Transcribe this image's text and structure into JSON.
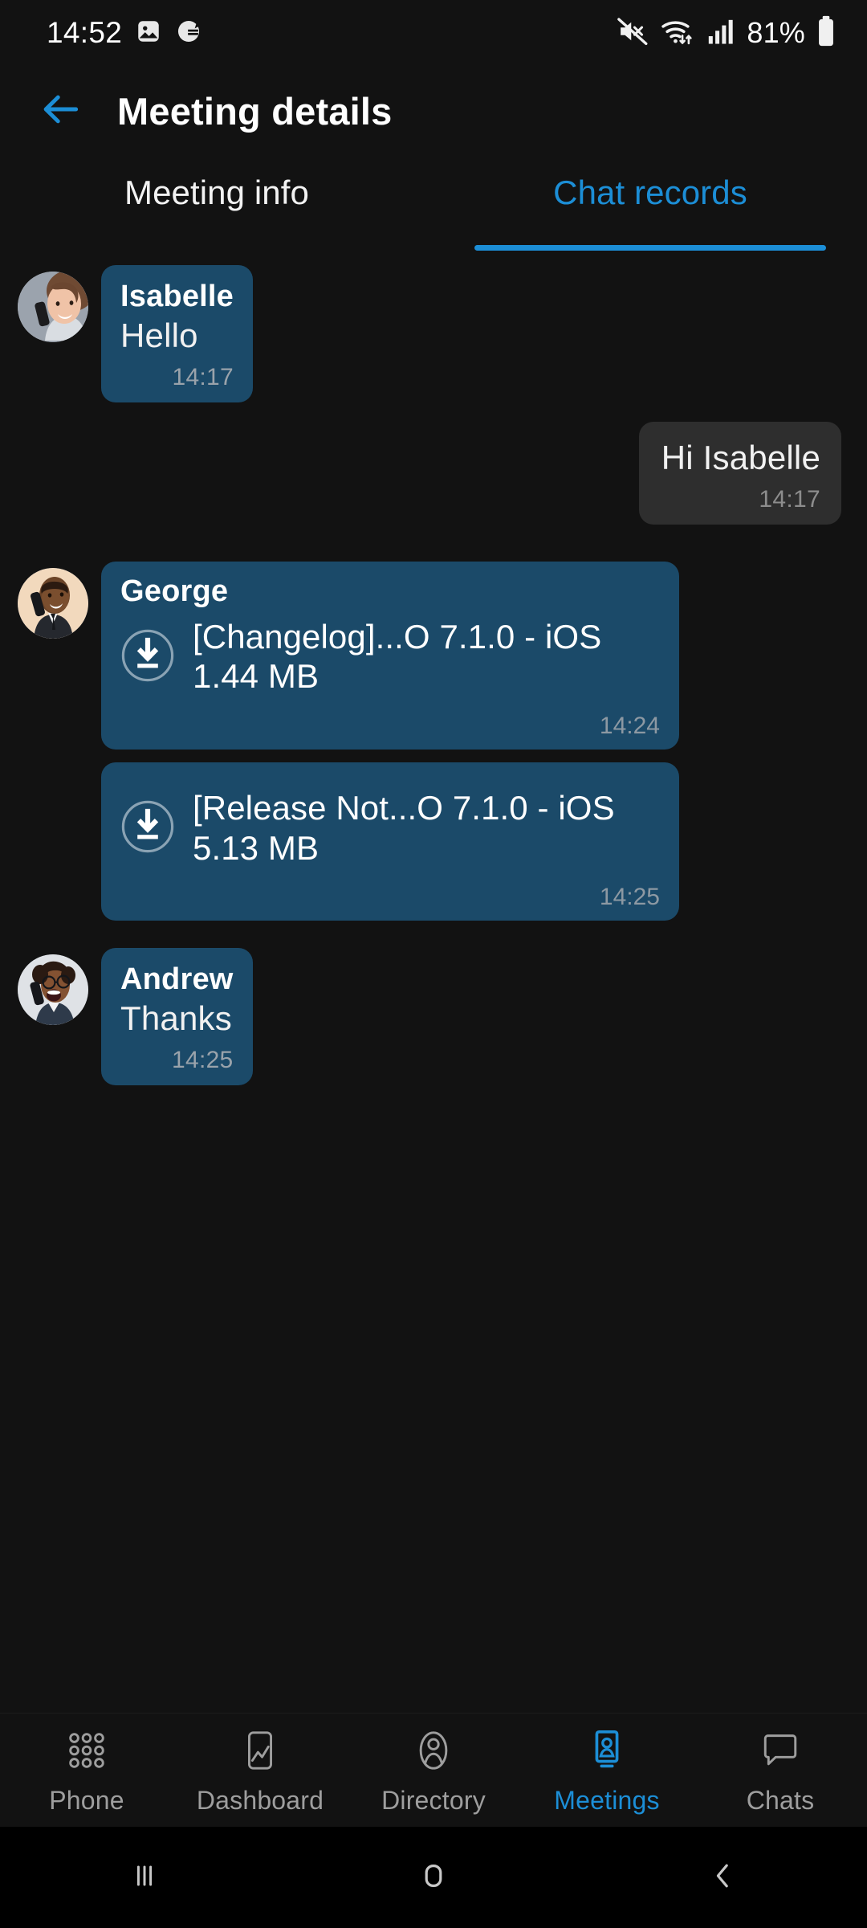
{
  "status_bar": {
    "time": "14:52",
    "battery_percent": "81%",
    "left_icons": [
      "image-icon",
      "app-badge-icon"
    ],
    "right_icons": [
      "mute-icon",
      "wifi-icon",
      "signal-bars-icon",
      "battery-icon"
    ]
  },
  "header": {
    "back_icon": "arrow-left-icon",
    "title": "Meeting details"
  },
  "tabs": {
    "items": [
      {
        "label": "Meeting info",
        "active": false
      },
      {
        "label": "Chat records",
        "active": true
      }
    ]
  },
  "chat": {
    "messages": [
      {
        "kind": "text",
        "direction": "incoming",
        "sender": "Isabelle",
        "text": "Hello",
        "time": "14:17",
        "avatar": "woman-on-phone-avatar"
      },
      {
        "kind": "text",
        "direction": "outgoing",
        "sender": "",
        "text": "Hi Isabelle",
        "time": "14:17",
        "avatar": ""
      },
      {
        "kind": "file",
        "direction": "incoming",
        "sender": "George",
        "file_name": "[Changelog]...O 7.1.0 - iOS",
        "file_size": "1.44 MB",
        "time": "14:24",
        "avatar": "man-on-phone-avatar",
        "action_icon": "download-icon"
      },
      {
        "kind": "file",
        "direction": "incoming",
        "sender": "",
        "file_name": "[Release Not...O 7.1.0 - iOS",
        "file_size": "5.13 MB",
        "time": "14:25",
        "avatar": "",
        "action_icon": "download-icon"
      },
      {
        "kind": "text",
        "direction": "incoming",
        "sender": "Andrew",
        "text": "Thanks",
        "time": "14:25",
        "avatar": "man-glasses-on-phone-avatar"
      }
    ]
  },
  "bottom_nav": {
    "items": [
      {
        "label": "Phone",
        "icon": "dialpad-icon",
        "active": false
      },
      {
        "label": "Dashboard",
        "icon": "dashboard-icon",
        "active": false
      },
      {
        "label": "Directory",
        "icon": "contact-icon",
        "active": false
      },
      {
        "label": "Meetings",
        "icon": "meetings-icon",
        "active": true
      },
      {
        "label": "Chats",
        "icon": "chat-bubble-icon",
        "active": false
      }
    ]
  },
  "android_nav": {
    "buttons": [
      "recents-icon",
      "home-icon",
      "back-icon"
    ]
  },
  "colors": {
    "background": "#121212",
    "accent": "#1c8ed6",
    "incoming_bubble": "#1b4a69",
    "outgoing_bubble": "#2e2e2e",
    "timestamp": "#9aa3ab"
  }
}
